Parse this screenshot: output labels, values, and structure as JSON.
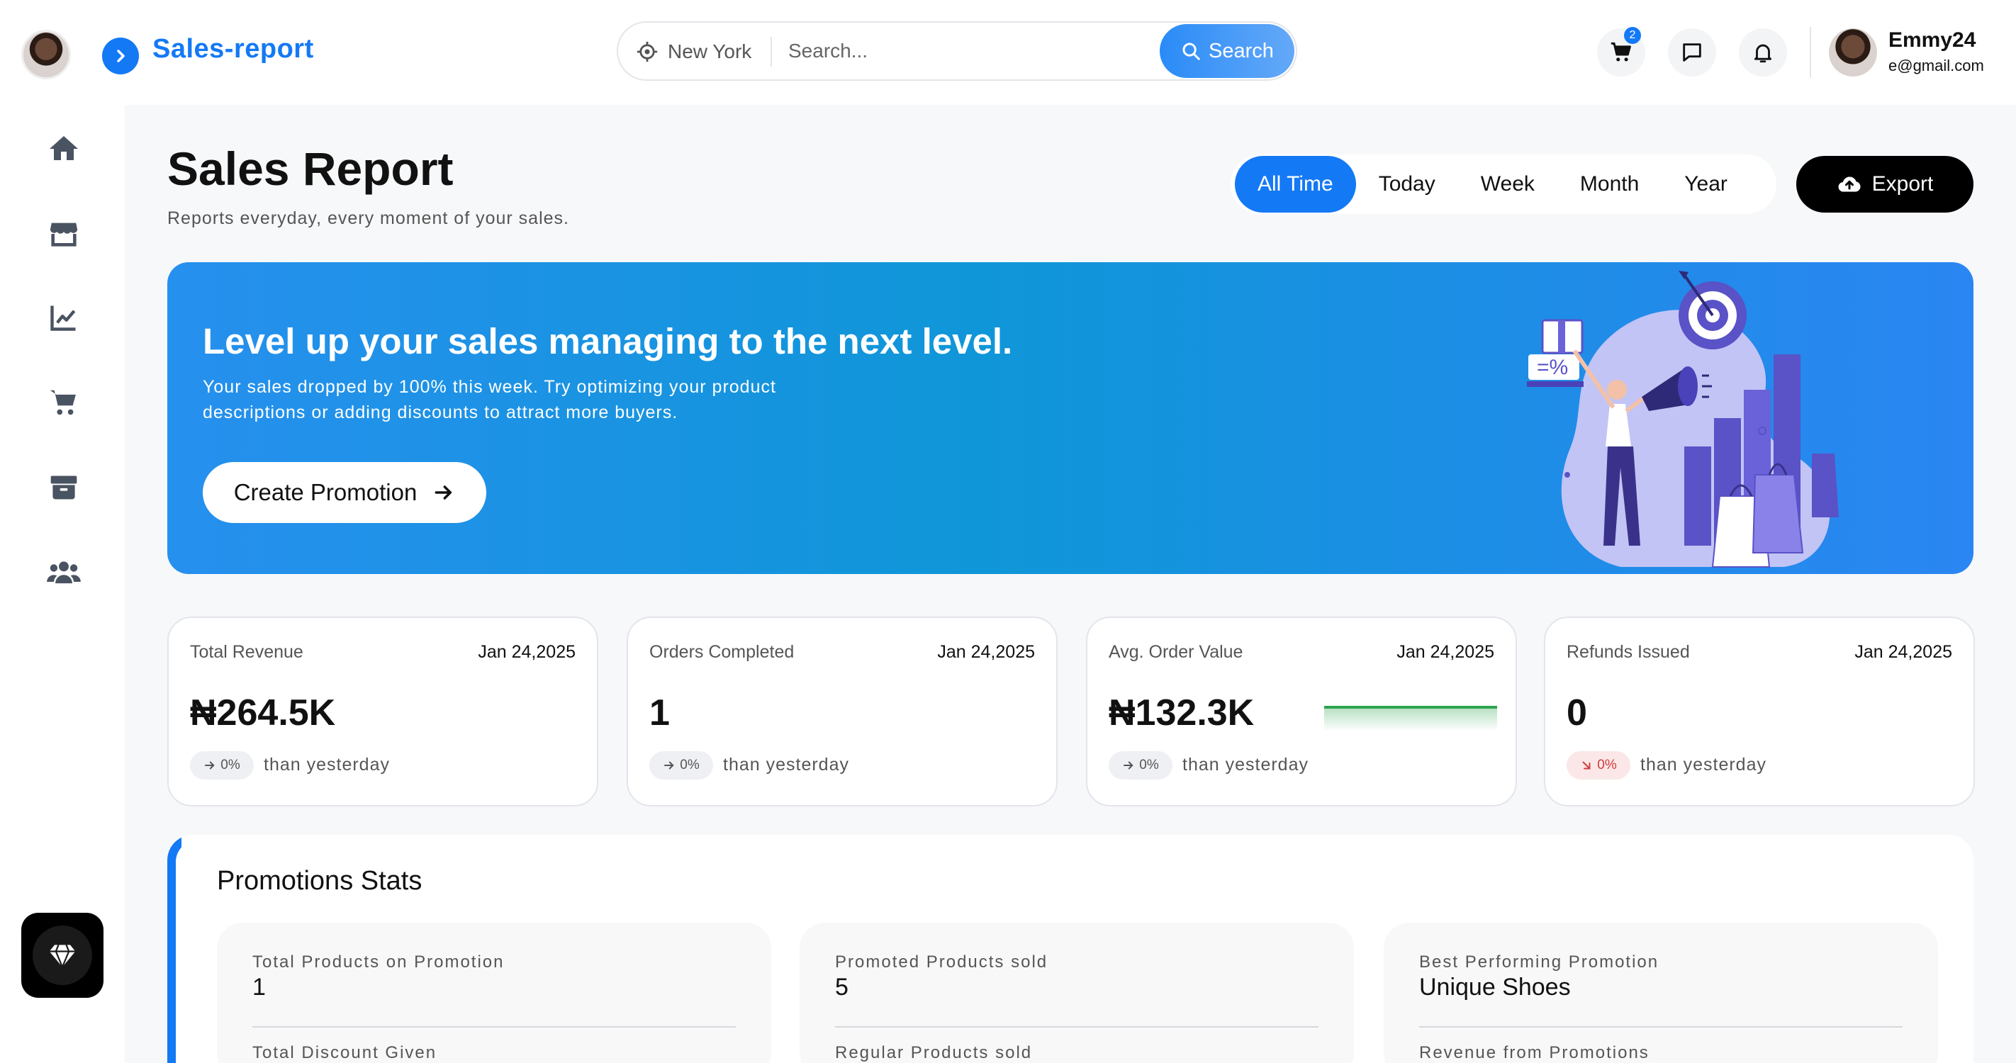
{
  "header": {
    "brand_title": "Sales-report",
    "location": "New York",
    "search_placeholder": "Search...",
    "search_button": "Search",
    "cart_count": "2",
    "user_name": "Emmy24",
    "user_email": "e@gmail.com"
  },
  "sidebar": {
    "items": [
      {
        "icon": "home-icon"
      },
      {
        "icon": "store-icon"
      },
      {
        "icon": "chart-icon"
      },
      {
        "icon": "cart-icon"
      },
      {
        "icon": "box-icon"
      },
      {
        "icon": "users-icon"
      }
    ],
    "premium_icon": "diamond-icon"
  },
  "page": {
    "title": "Sales Report",
    "subtitle": "Reports everyday, every moment of your sales."
  },
  "time_filter": {
    "tabs": [
      "All Time",
      "Today",
      "Week",
      "Month",
      "Year"
    ],
    "active": "All Time"
  },
  "export_label": "Export",
  "banner": {
    "title": "Level up your sales managing to the next level.",
    "text": "Your sales dropped by 100% this week. Try optimizing your product descriptions or adding discounts to attract more buyers.",
    "button": "Create Promotion"
  },
  "stats": [
    {
      "label": "Total Revenue",
      "date": "Jan 24,2025",
      "value": "₦264.5K",
      "change": "0%",
      "trend": "flat",
      "compare": "than yesterday"
    },
    {
      "label": "Orders Completed",
      "date": "Jan 24,2025",
      "value": "1",
      "change": "0%",
      "trend": "flat",
      "compare": "than yesterday"
    },
    {
      "label": "Avg. Order Value",
      "date": "Jan 24,2025",
      "value": "₦132.3K",
      "change": "0%",
      "trend": "flat",
      "compare": "than yesterday"
    },
    {
      "label": "Refunds Issued",
      "date": "Jan 24,2025",
      "value": "0",
      "change": "0%",
      "trend": "down",
      "compare": "than yesterday"
    }
  ],
  "promotions": {
    "title": "Promotions Stats",
    "cards": [
      {
        "label": "Total Products on Promotion",
        "value": "1",
        "label2": "Total Discount Given"
      },
      {
        "label": "Promoted Products sold",
        "value": "5",
        "label2": "Regular Products sold"
      },
      {
        "label": "Best Performing Promotion",
        "value": "Unique Shoes",
        "label2": "Revenue from Promotions"
      }
    ]
  },
  "colors": {
    "accent": "#1479f5",
    "banner_start": "#2690ee",
    "banner_end": "#2a86f2",
    "positive_line": "#2ea44f",
    "negative": "#d13b3b"
  }
}
